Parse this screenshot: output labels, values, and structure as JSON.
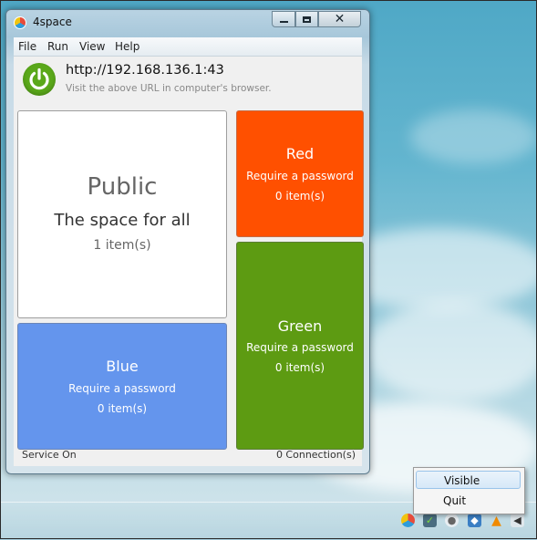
{
  "window": {
    "title": "4space"
  },
  "menu": [
    "File",
    "Run",
    "View",
    "Help"
  ],
  "server": {
    "url": "http://192.168.136.1:43",
    "hint": "Visit the above URL in computer's browser."
  },
  "spaces": {
    "public": {
      "name": "Public",
      "subtitle": "The space for all",
      "count": "1 item(s)",
      "color": "#ffffff"
    },
    "red": {
      "name": "Red",
      "subtitle": "Require a password",
      "count": "0 item(s)",
      "color": "#ff5000"
    },
    "green": {
      "name": "Green",
      "subtitle": "Require a password",
      "count": "0 item(s)",
      "color": "#5d9b12"
    },
    "blue": {
      "name": "Blue",
      "subtitle": "Require a password",
      "count": "0 item(s)",
      "color": "#6495ed"
    }
  },
  "status": {
    "left": "Service On",
    "right": "0 Connection(s)"
  },
  "context_menu": {
    "items": [
      "Visible",
      "Quit"
    ],
    "highlighted": "Visible"
  },
  "tray_icons": [
    "4space-tray-icon",
    "shield-check-icon",
    "chat-icon",
    "network-icon",
    "vlc-icon",
    "volume-icon"
  ]
}
